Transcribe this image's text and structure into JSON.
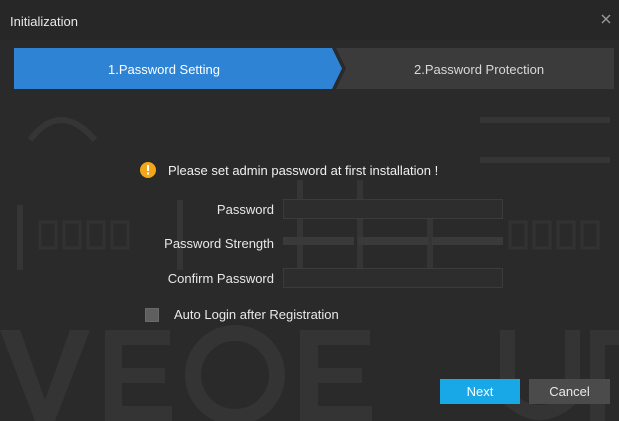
{
  "window": {
    "title": "Initialization"
  },
  "steps": [
    {
      "label": "1.Password Setting",
      "active": true
    },
    {
      "label": "2.Password Protection",
      "active": false
    }
  ],
  "notice": {
    "text": "Please set admin password at first installation !"
  },
  "form": {
    "password_label": "Password",
    "strength_label": "Password Strength",
    "confirm_label": "Confirm Password",
    "password_value": "",
    "confirm_value": ""
  },
  "options": {
    "auto_login_label": "Auto Login after Registration",
    "auto_login_checked": false
  },
  "buttons": {
    "next": "Next",
    "cancel": "Cancel"
  },
  "colors": {
    "accent": "#18a7e7",
    "step_active": "#2f83d4",
    "warning": "#f2a71b"
  }
}
